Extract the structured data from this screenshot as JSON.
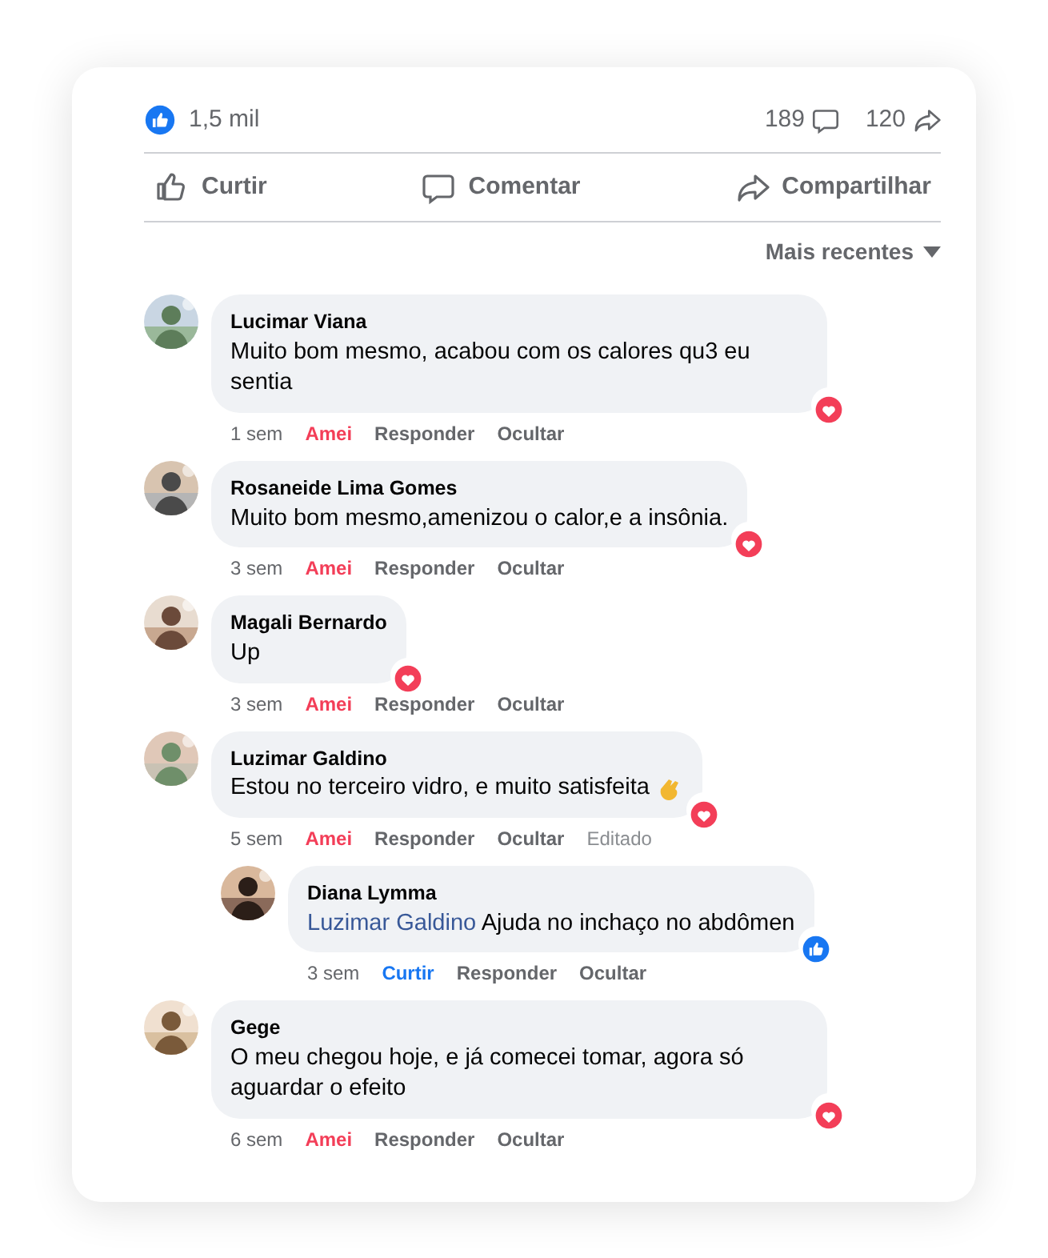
{
  "stats": {
    "likes": "1,5 mil",
    "comments": "189",
    "shares": "120"
  },
  "actions": [
    {
      "kind": "like",
      "label": "Curtir"
    },
    {
      "kind": "comment",
      "label": "Comentar"
    },
    {
      "kind": "share",
      "label": "Compartilhar"
    }
  ],
  "sort": {
    "label": "Mais recentes"
  },
  "comments": [
    {
      "name": "Lucimar Viana",
      "text": "Muito bom mesmo, acabou com os calores qu3 eu sentia",
      "reaction": {
        "kind": "love"
      },
      "meta": [
        {
          "kind": "time",
          "label": "1 sem"
        },
        {
          "kind": "love",
          "label": "Amei"
        },
        {
          "kind": "action",
          "label": "Responder"
        },
        {
          "kind": "action",
          "label": "Ocultar"
        }
      ]
    },
    {
      "name": "Rosaneide Lima Gomes",
      "text": "Muito bom mesmo,amenizou o calor,e a insônia.",
      "reaction": {
        "kind": "love"
      },
      "meta": [
        {
          "kind": "time",
          "label": "3 sem"
        },
        {
          "kind": "love",
          "label": "Amei"
        },
        {
          "kind": "action",
          "label": "Responder"
        },
        {
          "kind": "action",
          "label": "Ocultar"
        }
      ]
    },
    {
      "name": "Magali Bernardo",
      "text": "Up",
      "reaction": {
        "kind": "love"
      },
      "meta": [
        {
          "kind": "time",
          "label": "3 sem"
        },
        {
          "kind": "love",
          "label": "Amei"
        },
        {
          "kind": "action",
          "label": "Responder"
        },
        {
          "kind": "action",
          "label": "Ocultar"
        }
      ]
    },
    {
      "name": "Luzimar Galdino",
      "text": "Estou no terceiro vidro, e muito satisfeita",
      "emoji": true,
      "reaction": {
        "kind": "love"
      },
      "meta": [
        {
          "kind": "time",
          "label": "5 sem"
        },
        {
          "kind": "love",
          "label": "Amei"
        },
        {
          "kind": "action",
          "label": "Responder"
        },
        {
          "kind": "action",
          "label": "Ocultar"
        },
        {
          "kind": "time",
          "label": "Editado"
        }
      ],
      "children": [
        {
          "name": "Diana Lymma",
          "mention": "Luzimar Galdino",
          "text": "Ajuda no inchaço no abdômen",
          "reaction": {
            "kind": "like"
          },
          "meta": [
            {
              "kind": "time",
              "label": "3 sem"
            },
            {
              "kind": "like",
              "label": "Curtir"
            },
            {
              "kind": "action",
              "label": "Responder"
            },
            {
              "kind": "action",
              "label": "Ocultar"
            }
          ]
        }
      ]
    },
    {
      "name": "Gege",
      "text": "O meu chegou hoje, e já comecei tomar, agora só aguardar o efeito",
      "reaction": {
        "kind": "love"
      },
      "meta": [
        {
          "kind": "time",
          "label": "6 sem"
        },
        {
          "kind": "love",
          "label": "Amei"
        },
        {
          "kind": "action",
          "label": "Responder"
        },
        {
          "kind": "action",
          "label": "Ocultar"
        }
      ]
    }
  ]
}
